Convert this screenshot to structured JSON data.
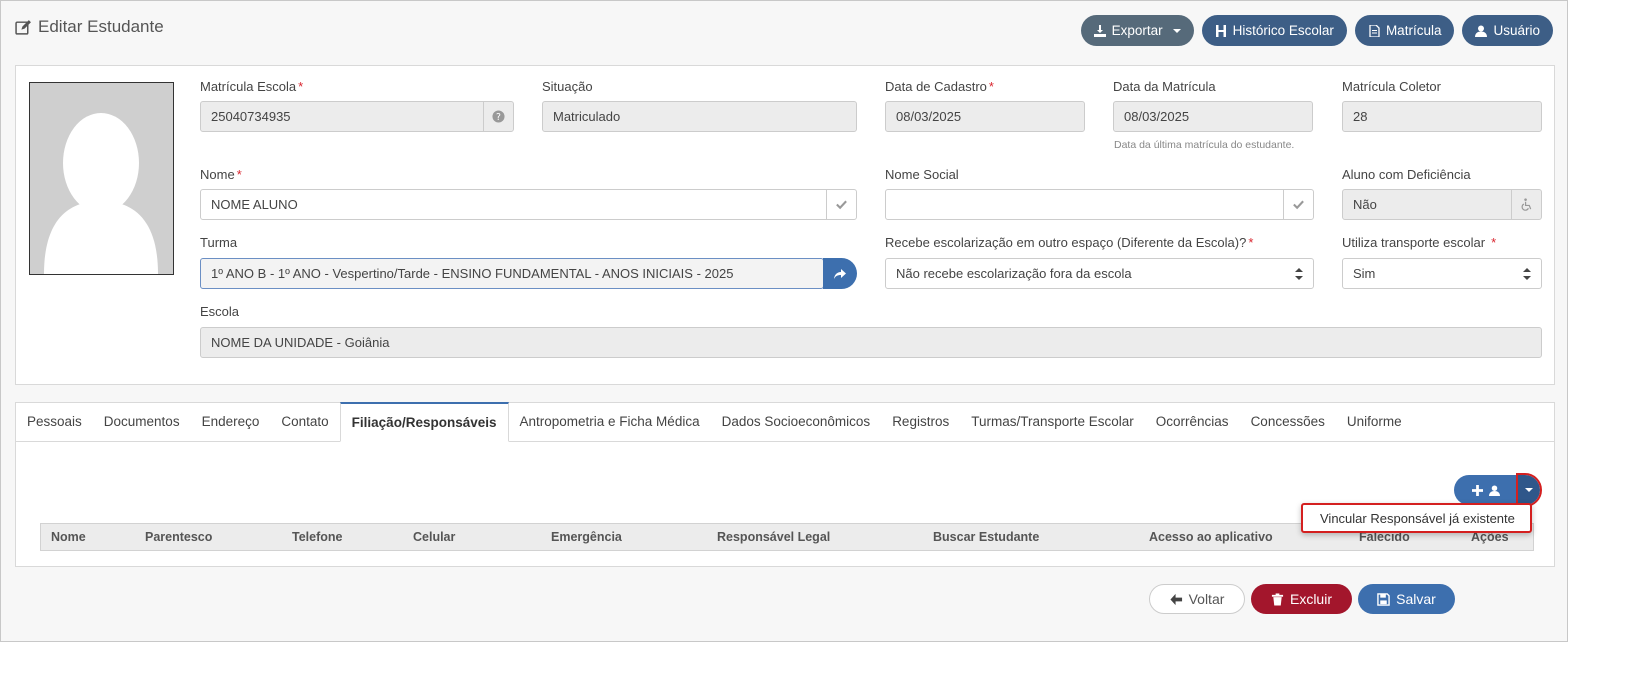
{
  "header": {
    "title": "Editar Estudante",
    "actions": {
      "exportar": "Exportar",
      "historico": "Histórico Escolar",
      "matricula": "Matrícula",
      "usuario": "Usuário"
    }
  },
  "form": {
    "matricula_escola": {
      "label": "Matrícula Escola",
      "value": "25040734935"
    },
    "situacao": {
      "label": "Situação",
      "value": "Matriculado"
    },
    "data_cadastro": {
      "label": "Data de Cadastro",
      "value": "08/03/2025"
    },
    "data_matricula": {
      "label": "Data da Matrícula",
      "value": "08/03/2025",
      "help": "Data da última matrícula do estudante."
    },
    "matricula_coletor": {
      "label": "Matrícula Coletor",
      "value": "28"
    },
    "nome": {
      "label": "Nome",
      "value": "NOME ALUNO"
    },
    "nome_social": {
      "label": "Nome Social",
      "value": ""
    },
    "aluno_deficiencia": {
      "label": "Aluno com Deficiência",
      "value": "Não"
    },
    "turma": {
      "label": "Turma",
      "value": "1º ANO B - 1º ANO - Vespertino/Tarde - ENSINO FUNDAMENTAL - ANOS INICIAIS - 2025"
    },
    "escolarizacao": {
      "label": "Recebe escolarização em outro espaço (Diferente da Escola)?",
      "value": "Não recebe escolarização fora da escola"
    },
    "transporte": {
      "label": "Utiliza transporte escolar",
      "value": "Sim"
    },
    "escola": {
      "label": "Escola",
      "value": "NOME DA UNIDADE - Goiânia"
    },
    "required_mark": "*"
  },
  "tabs": [
    "Pessoais",
    "Documentos",
    "Endereço",
    "Contato",
    "Filiação/Responsáveis",
    "Antropometria e Ficha Médica",
    "Dados Socioeconômicos",
    "Registros",
    "Turmas/Transporte Escolar",
    "Ocorrências",
    "Concessões",
    "Uniforme"
  ],
  "active_tab": "Filiação/Responsáveis",
  "grid": {
    "columns": [
      "Nome",
      "Parentesco",
      "Telefone",
      "Celular",
      "Emergência",
      "Responsável Legal",
      "Buscar Estudante",
      "Acesso ao aplicativo",
      "Falecido",
      "Ações"
    ]
  },
  "dropdown": {
    "item": "Vincular Responsável já existente"
  },
  "footer": {
    "voltar": "Voltar",
    "excluir": "Excluir",
    "salvar": "Salvar"
  },
  "colors": {
    "primary": "#3d6fae",
    "navy": "#3d5e86",
    "gray": "#566a7a",
    "danger": "#a3162c",
    "highlight": "#d42020"
  }
}
